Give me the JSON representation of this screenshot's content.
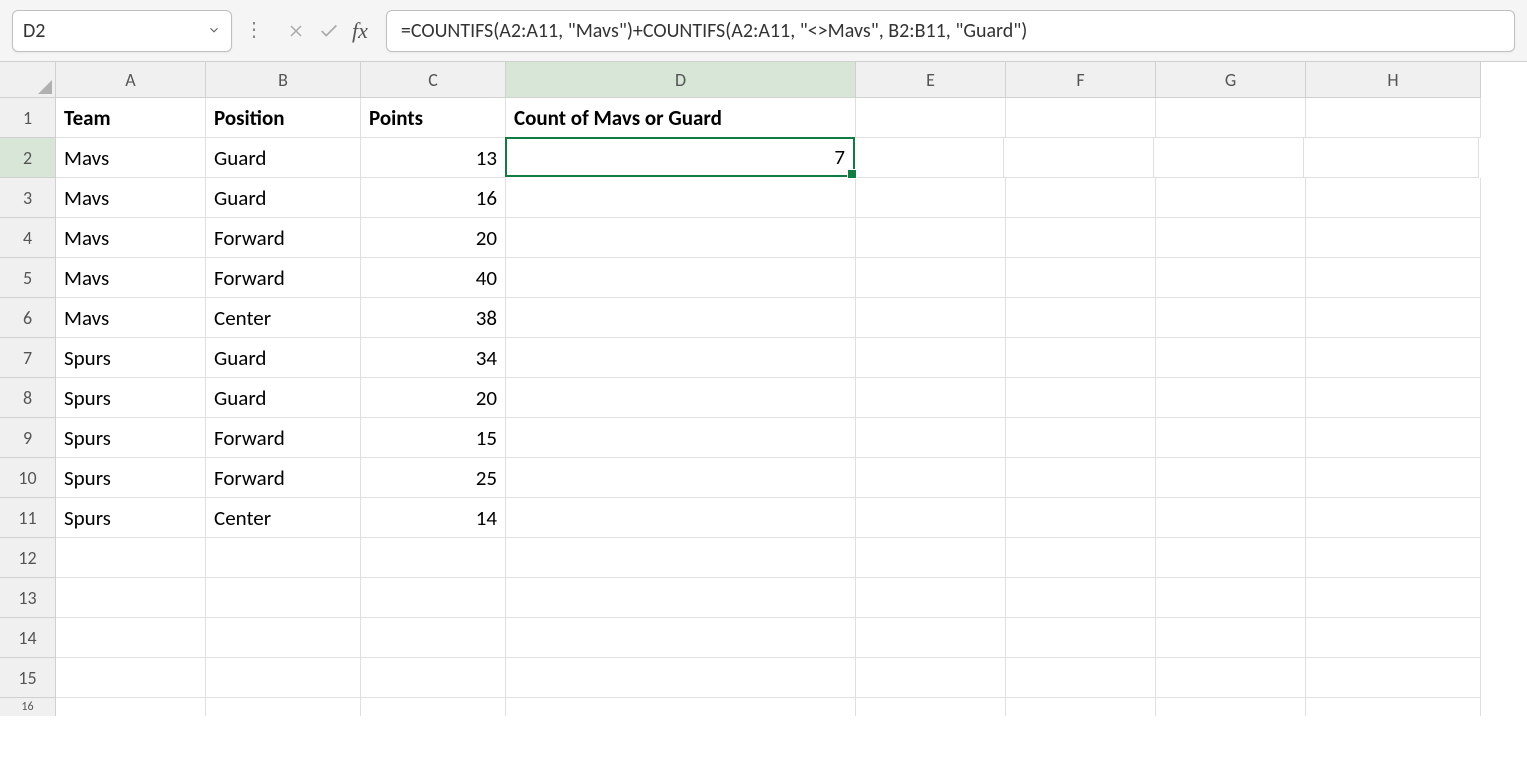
{
  "nameBox": {
    "value": "D2"
  },
  "formulaBar": {
    "value": "=COUNTIFS(A2:A11, \"Mavs\")+COUNTIFS(A2:A11, \"<>Mavs\", B2:B11, \"Guard\")"
  },
  "columns": [
    "A",
    "B",
    "C",
    "D",
    "E",
    "F",
    "G",
    "H"
  ],
  "selectedColumn": "D",
  "selectedRow": "2",
  "activeCell": "D2",
  "headers": {
    "A": "Team",
    "B": "Position",
    "C": "Points",
    "D": "Count of Mavs or Guard"
  },
  "rows": [
    {
      "num": "1",
      "A": "Team",
      "B": "Position",
      "C": "Points",
      "D": "Count of Mavs or Guard",
      "bold": true
    },
    {
      "num": "2",
      "A": "Mavs",
      "B": "Guard",
      "C": "13",
      "D": "7",
      "active": "D"
    },
    {
      "num": "3",
      "A": "Mavs",
      "B": "Guard",
      "C": "16",
      "D": ""
    },
    {
      "num": "4",
      "A": "Mavs",
      "B": "Forward",
      "C": "20",
      "D": ""
    },
    {
      "num": "5",
      "A": "Mavs",
      "B": "Forward",
      "C": "40",
      "D": ""
    },
    {
      "num": "6",
      "A": "Mavs",
      "B": "Center",
      "C": "38",
      "D": ""
    },
    {
      "num": "7",
      "A": "Spurs",
      "B": "Guard",
      "C": "34",
      "D": ""
    },
    {
      "num": "8",
      "A": "Spurs",
      "B": "Guard",
      "C": "20",
      "D": ""
    },
    {
      "num": "9",
      "A": "Spurs",
      "B": "Forward",
      "C": "15",
      "D": ""
    },
    {
      "num": "10",
      "A": "Spurs",
      "B": "Forward",
      "C": "25",
      "D": ""
    },
    {
      "num": "11",
      "A": "Spurs",
      "B": "Center",
      "C": "14",
      "D": ""
    },
    {
      "num": "12",
      "A": "",
      "B": "",
      "C": "",
      "D": ""
    },
    {
      "num": "13",
      "A": "",
      "B": "",
      "C": "",
      "D": ""
    },
    {
      "num": "14",
      "A": "",
      "B": "",
      "C": "",
      "D": ""
    },
    {
      "num": "15",
      "A": "",
      "B": "",
      "C": "",
      "D": ""
    }
  ],
  "partialRow": "16"
}
